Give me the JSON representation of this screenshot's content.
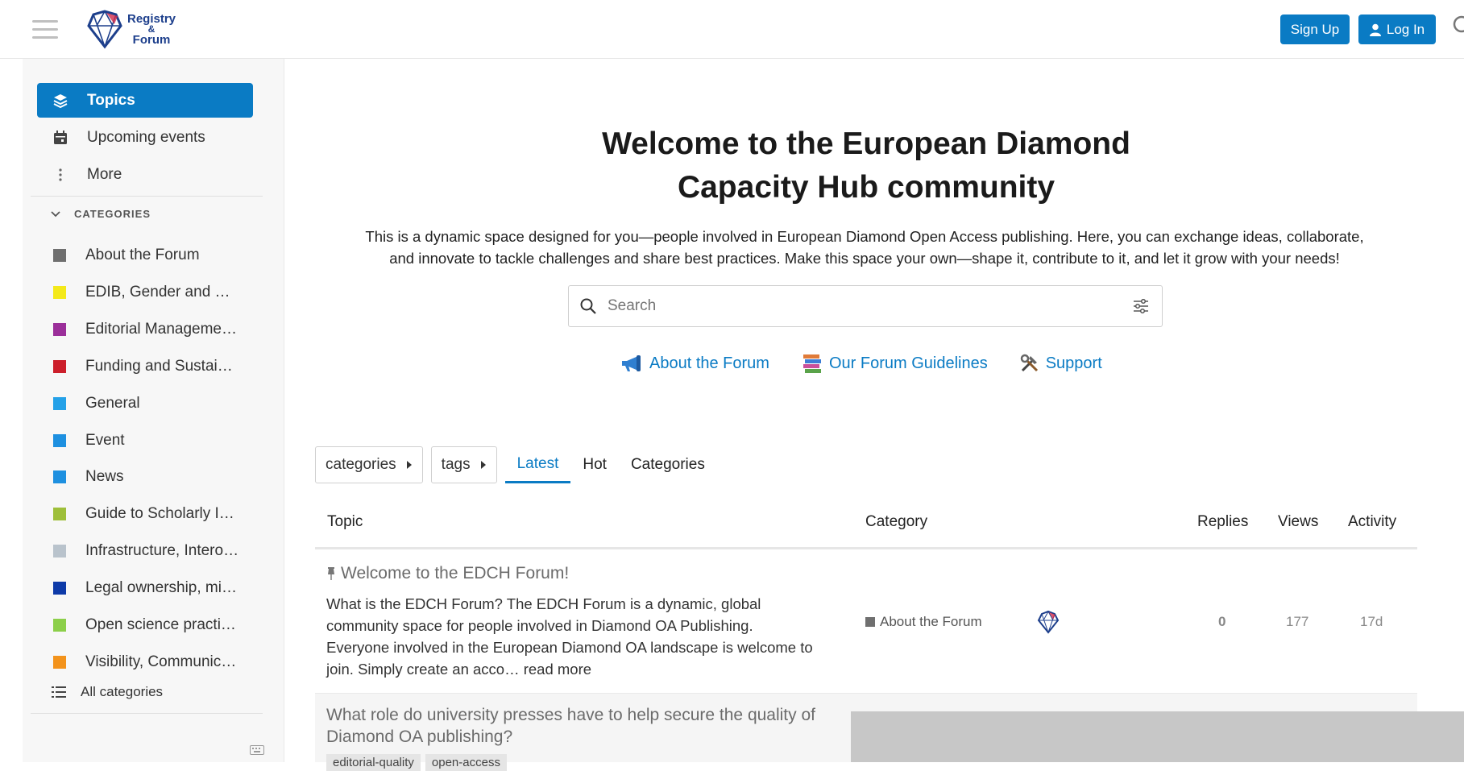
{
  "header": {
    "logo_line1": "Registry",
    "logo_line2": "&",
    "logo_line3": "Forum",
    "signup_label": "Sign Up",
    "login_label": "Log In",
    "brand_color": "#0a7bc4"
  },
  "sidebar": {
    "nav": [
      {
        "label": "Topics",
        "icon": "layers-icon"
      },
      {
        "label": "Upcoming events",
        "icon": "calendar-icon"
      },
      {
        "label": "More",
        "icon": "vertical-dots-icon"
      }
    ],
    "categories_header": "CATEGORIES",
    "categories": [
      {
        "label": "About the Forum",
        "color": "#6f6f6f"
      },
      {
        "label": "EDIB, Gender and …",
        "color": "#f4e91a"
      },
      {
        "label": "Editorial Manageme…",
        "color": "#9b2f9a"
      },
      {
        "label": "Funding and Sustai…",
        "color": "#cc1f2b"
      },
      {
        "label": "General",
        "color": "#24a1e8"
      },
      {
        "label": "Event",
        "color": "#1e90e0"
      },
      {
        "label": "News",
        "color": "#1e90e0"
      },
      {
        "label": "Guide to Scholarly I…",
        "color": "#9ebf3a"
      },
      {
        "label": "Infrastructure, Intero…",
        "color": "#b9c3cc"
      },
      {
        "label": "Legal ownership, mi…",
        "color": "#0d3aa8"
      },
      {
        "label": "Open science practi…",
        "color": "#8ccf4a"
      },
      {
        "label": "Visibility, Communic…",
        "color": "#f3931c"
      }
    ],
    "all_categories": "All categories"
  },
  "welcome": {
    "title_line1": "Welcome to the European Diamond",
    "title_line2": "Capacity Hub community",
    "desc_line1": "This is a dynamic space designed for you—people involved in European Diamond Open Access publishing. Here, you can exchange ideas, collaborate,",
    "desc_line2": "and innovate to tackle challenges and share best practices. Make this space your own—shape it, contribute to it, and let it grow with your needs!"
  },
  "search": {
    "placeholder": "Search"
  },
  "quick_links": [
    {
      "label": "About the Forum",
      "icon": "megaphone-icon"
    },
    {
      "label": "Our Forum Guidelines",
      "icon": "books-icon"
    },
    {
      "label": "Support",
      "icon": "tools-icon"
    }
  ],
  "filters": {
    "categories_dropdown": "categories",
    "tags_dropdown": "tags",
    "tabs": [
      "Latest",
      "Hot",
      "Categories"
    ],
    "active_tab": "Latest"
  },
  "table": {
    "columns": [
      "Topic",
      "Category",
      "Replies",
      "Views",
      "Activity"
    ],
    "rows": [
      {
        "title": "Welcome to the EDCH Forum!",
        "pinned": true,
        "excerpt_lines": [
          "What is the EDCH Forum? The EDCH Forum is a dynamic, global",
          "community space for people involved in Diamond OA Publishing.",
          "Everyone involved in the European Diamond OA landscape is welcome to",
          "join. Simply create an acco… read more"
        ],
        "category": "About the Forum",
        "category_color": "#6f6f6f",
        "replies": "0",
        "views": "177",
        "activity": "17d"
      },
      {
        "title_line1": "What role do university presses have to help secure the quality of",
        "title_line2": "Diamond OA publishing?",
        "tags": [
          "editorial-quality",
          "open-access"
        ]
      }
    ]
  }
}
